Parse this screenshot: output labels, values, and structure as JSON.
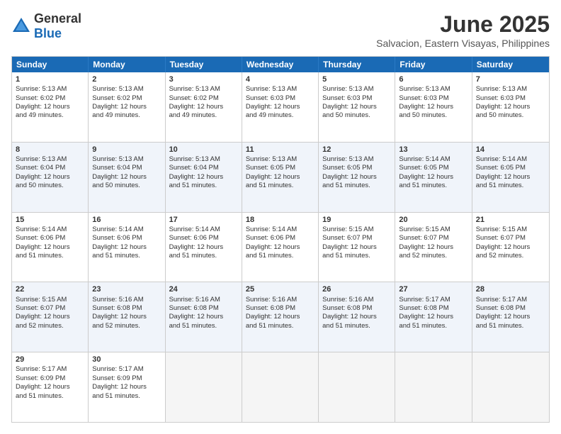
{
  "header": {
    "logo_general": "General",
    "logo_blue": "Blue",
    "month": "June 2025",
    "location": "Salvacion, Eastern Visayas, Philippines"
  },
  "weekdays": [
    "Sunday",
    "Monday",
    "Tuesday",
    "Wednesday",
    "Thursday",
    "Friday",
    "Saturday"
  ],
  "rows": [
    {
      "alt": false,
      "cells": [
        {
          "day": "1",
          "content": "Sunrise: 5:13 AM\nSunset: 6:02 PM\nDaylight: 12 hours\nand 49 minutes."
        },
        {
          "day": "2",
          "content": "Sunrise: 5:13 AM\nSunset: 6:02 PM\nDaylight: 12 hours\nand 49 minutes."
        },
        {
          "day": "3",
          "content": "Sunrise: 5:13 AM\nSunset: 6:02 PM\nDaylight: 12 hours\nand 49 minutes."
        },
        {
          "day": "4",
          "content": "Sunrise: 5:13 AM\nSunset: 6:03 PM\nDaylight: 12 hours\nand 49 minutes."
        },
        {
          "day": "5",
          "content": "Sunrise: 5:13 AM\nSunset: 6:03 PM\nDaylight: 12 hours\nand 50 minutes."
        },
        {
          "day": "6",
          "content": "Sunrise: 5:13 AM\nSunset: 6:03 PM\nDaylight: 12 hours\nand 50 minutes."
        },
        {
          "day": "7",
          "content": "Sunrise: 5:13 AM\nSunset: 6:03 PM\nDaylight: 12 hours\nand 50 minutes."
        }
      ]
    },
    {
      "alt": true,
      "cells": [
        {
          "day": "8",
          "content": "Sunrise: 5:13 AM\nSunset: 6:04 PM\nDaylight: 12 hours\nand 50 minutes."
        },
        {
          "day": "9",
          "content": "Sunrise: 5:13 AM\nSunset: 6:04 PM\nDaylight: 12 hours\nand 50 minutes."
        },
        {
          "day": "10",
          "content": "Sunrise: 5:13 AM\nSunset: 6:04 PM\nDaylight: 12 hours\nand 51 minutes."
        },
        {
          "day": "11",
          "content": "Sunrise: 5:13 AM\nSunset: 6:05 PM\nDaylight: 12 hours\nand 51 minutes."
        },
        {
          "day": "12",
          "content": "Sunrise: 5:13 AM\nSunset: 6:05 PM\nDaylight: 12 hours\nand 51 minutes."
        },
        {
          "day": "13",
          "content": "Sunrise: 5:14 AM\nSunset: 6:05 PM\nDaylight: 12 hours\nand 51 minutes."
        },
        {
          "day": "14",
          "content": "Sunrise: 5:14 AM\nSunset: 6:05 PM\nDaylight: 12 hours\nand 51 minutes."
        }
      ]
    },
    {
      "alt": false,
      "cells": [
        {
          "day": "15",
          "content": "Sunrise: 5:14 AM\nSunset: 6:06 PM\nDaylight: 12 hours\nand 51 minutes."
        },
        {
          "day": "16",
          "content": "Sunrise: 5:14 AM\nSunset: 6:06 PM\nDaylight: 12 hours\nand 51 minutes."
        },
        {
          "day": "17",
          "content": "Sunrise: 5:14 AM\nSunset: 6:06 PM\nDaylight: 12 hours\nand 51 minutes."
        },
        {
          "day": "18",
          "content": "Sunrise: 5:14 AM\nSunset: 6:06 PM\nDaylight: 12 hours\nand 51 minutes."
        },
        {
          "day": "19",
          "content": "Sunrise: 5:15 AM\nSunset: 6:07 PM\nDaylight: 12 hours\nand 51 minutes."
        },
        {
          "day": "20",
          "content": "Sunrise: 5:15 AM\nSunset: 6:07 PM\nDaylight: 12 hours\nand 52 minutes."
        },
        {
          "day": "21",
          "content": "Sunrise: 5:15 AM\nSunset: 6:07 PM\nDaylight: 12 hours\nand 52 minutes."
        }
      ]
    },
    {
      "alt": true,
      "cells": [
        {
          "day": "22",
          "content": "Sunrise: 5:15 AM\nSunset: 6:07 PM\nDaylight: 12 hours\nand 52 minutes."
        },
        {
          "day": "23",
          "content": "Sunrise: 5:16 AM\nSunset: 6:08 PM\nDaylight: 12 hours\nand 52 minutes."
        },
        {
          "day": "24",
          "content": "Sunrise: 5:16 AM\nSunset: 6:08 PM\nDaylight: 12 hours\nand 51 minutes."
        },
        {
          "day": "25",
          "content": "Sunrise: 5:16 AM\nSunset: 6:08 PM\nDaylight: 12 hours\nand 51 minutes."
        },
        {
          "day": "26",
          "content": "Sunrise: 5:16 AM\nSunset: 6:08 PM\nDaylight: 12 hours\nand 51 minutes."
        },
        {
          "day": "27",
          "content": "Sunrise: 5:17 AM\nSunset: 6:08 PM\nDaylight: 12 hours\nand 51 minutes."
        },
        {
          "day": "28",
          "content": "Sunrise: 5:17 AM\nSunset: 6:08 PM\nDaylight: 12 hours\nand 51 minutes."
        }
      ]
    },
    {
      "alt": false,
      "cells": [
        {
          "day": "29",
          "content": "Sunrise: 5:17 AM\nSunset: 6:09 PM\nDaylight: 12 hours\nand 51 minutes."
        },
        {
          "day": "30",
          "content": "Sunrise: 5:17 AM\nSunset: 6:09 PM\nDaylight: 12 hours\nand 51 minutes."
        },
        {
          "day": "",
          "content": ""
        },
        {
          "day": "",
          "content": ""
        },
        {
          "day": "",
          "content": ""
        },
        {
          "day": "",
          "content": ""
        },
        {
          "day": "",
          "content": ""
        }
      ]
    }
  ]
}
